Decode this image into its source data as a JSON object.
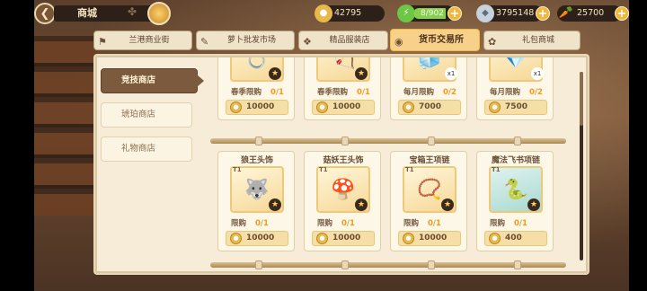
{
  "topbar": {
    "back_icon": "back-arrow-icon",
    "title": "商城",
    "gold": "42795",
    "energy": "8/902",
    "energy_fill_fraction": 0.9,
    "gems": "3795148",
    "carrots": "25700"
  },
  "tabs": [
    {
      "label": "兰港商业街",
      "icon": "shop-icon",
      "active": false
    },
    {
      "label": "萝卜批发市场",
      "icon": "carrot-market-icon",
      "active": false
    },
    {
      "label": "精品服装店",
      "icon": "clothes-icon",
      "active": false
    },
    {
      "label": "货币交易所",
      "icon": "coin-exchange-icon",
      "active": true
    },
    {
      "label": "礼包商城",
      "icon": "gift-icon",
      "active": false
    }
  ],
  "side_menu": [
    {
      "label": "竞技商店",
      "active": true
    },
    {
      "label": "琥珀商店",
      "active": false
    },
    {
      "label": "礼物商店",
      "active": false
    }
  ],
  "row1": [
    {
      "name": "",
      "limit_label": "春季限购",
      "limit": "0/1",
      "price": "10000"
    },
    {
      "name": "",
      "limit_label": "春季限购",
      "limit": "0/1",
      "price": "10000"
    },
    {
      "name": "",
      "limit_label": "每月限购",
      "limit": "0/2",
      "price": "7000"
    },
    {
      "name": "",
      "limit_label": "每月限购",
      "limit": "0/2",
      "price": "7500"
    }
  ],
  "row2": [
    {
      "name": "狼王头饰",
      "tier": "T1",
      "limit_label": "限购",
      "limit": "0/1",
      "price": "10000",
      "icon": "🐺"
    },
    {
      "name": "菇妖王头饰",
      "tier": "T1",
      "limit_label": "限购",
      "limit": "0/1",
      "price": "10000",
      "icon": "🍄"
    },
    {
      "name": "宝箱王项链",
      "tier": "T1",
      "limit_label": "限购",
      "limit": "0/1",
      "price": "10000",
      "icon": "📿"
    },
    {
      "name": "魔法飞书项链",
      "tier": "T1",
      "limit_label": "限购",
      "limit": "0/1",
      "price": "400",
      "icon": "🐍"
    }
  ],
  "row1_icons": [
    "💍",
    "🏹",
    "🧊",
    "💎"
  ],
  "row1_tags": [
    "",
    "",
    "x1",
    "x1"
  ]
}
